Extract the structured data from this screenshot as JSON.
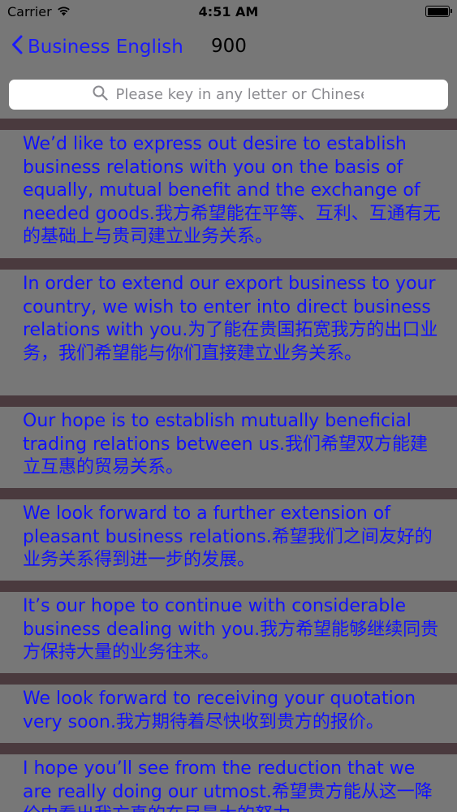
{
  "status_bar": {
    "carrier": "Carrier",
    "time": "4:51 AM"
  },
  "nav": {
    "back_label": "Business English",
    "title": "900"
  },
  "search": {
    "placeholder": "Please key in any letter or Chinese",
    "value": ""
  },
  "sentences": [
    "We’d like to express out desire to establish business relations with you on the basis of equally, mutual benefit and the exchange of needed goods.我方希望能在平等、互利、互通有无的基础上与贵司建立业务关系。",
    "In order to extend our export business to your country, we wish to enter into direct business relations with you.为了能在贵国拓宽我方的出口业务，我们希望能与你们直接建立业务关系。",
    "Our hope is to establish mutually beneficial trading relations between us.我们希望双方能建立互惠的贸易关系。",
    "We look forward to a further extension of pleasant business relations.希望我们之间友好的业务关系得到进一步的发展。",
    "It’s our hope to continue with considerable business dealing with you.我方希望能够继续同贵方保持大量的业务往来。",
    "We look forward to receiving your quotation very soon.我方期待着尽快收到贵方的报价。",
    "I hope you’ll see from the reduction that we are really doing our utmost.希望贵方能从这一降价中看出我方真的在尽最大的努力。"
  ],
  "colors": {
    "background": "#777777",
    "accent": "#1a1aff",
    "separator": "#4a3a3e"
  }
}
